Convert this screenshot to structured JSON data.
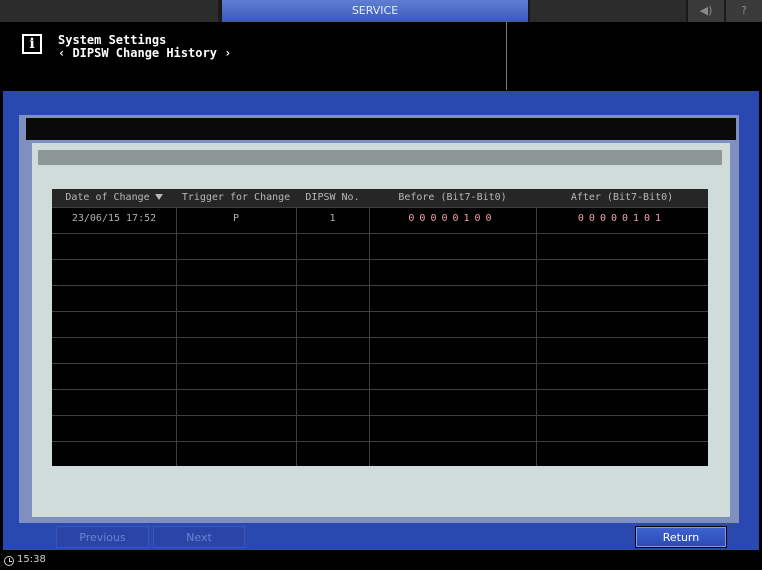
{
  "topbar": {
    "service_label": "SERVICE",
    "volume_icon": "volume-icon",
    "volume_symbol": "◀)",
    "help_symbol": "?"
  },
  "header": {
    "info_icon": "info-icon",
    "info_symbol": "i",
    "title": "System Settings",
    "subtitle": "‹ DIPSW Change History ›"
  },
  "table": {
    "columns": [
      "Date of Change",
      "Trigger for Change",
      "DIPSW No.",
      "Before (Bit7-Bit0)",
      "After (Bit7-Bit0)"
    ],
    "sort_icon": "sort-down-arrow-icon",
    "rows": [
      {
        "date": "23/06/15 17:52",
        "trigger": "P",
        "dipsw_no": "1",
        "before": "00000100",
        "after": "00000101"
      }
    ]
  },
  "buttons": {
    "previous": "Previous",
    "next": "Next",
    "return": "Return"
  },
  "status": {
    "clock_icon": "clock-icon",
    "time": "15:38"
  },
  "colors": {
    "frame_blue": "#2948b0",
    "service_tab": "#4a6ac8",
    "bit_value_pink": "#f0a0a6"
  }
}
